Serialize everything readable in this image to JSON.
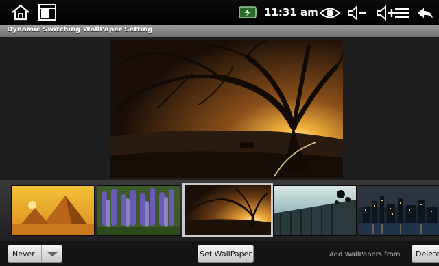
{
  "status_bar": {
    "time": "11:31 am",
    "icons": [
      "home-icon",
      "recent-apps-icon",
      "battery-icon",
      "eye-icon",
      "volume-down-icon",
      "volume-up-icon",
      "menu-icon",
      "back-icon"
    ]
  },
  "app": {
    "title": "Dynamic Switching WallPaper Setting"
  },
  "preview": {
    "image": "tree-sunset-wallpaper"
  },
  "thumbnails": [
    {
      "image": "pyramids-wallpaper",
      "selected": false
    },
    {
      "image": "lavender-field-wallpaper",
      "selected": false
    },
    {
      "image": "tree-sunset-wallpaper",
      "selected": true
    },
    {
      "image": "bridge-sky-wallpaper",
      "selected": false
    },
    {
      "image": "city-night-wallpaper",
      "selected": false
    }
  ],
  "controls": {
    "interval_value": "Never",
    "set_button": "Set WallPaper",
    "add_label": "Add WallPapers from",
    "delete_button": "Delete"
  },
  "colors": {
    "status_bar": "#000000",
    "title_bar": "#8a8a8a",
    "battery_green": "#5fd35f"
  }
}
